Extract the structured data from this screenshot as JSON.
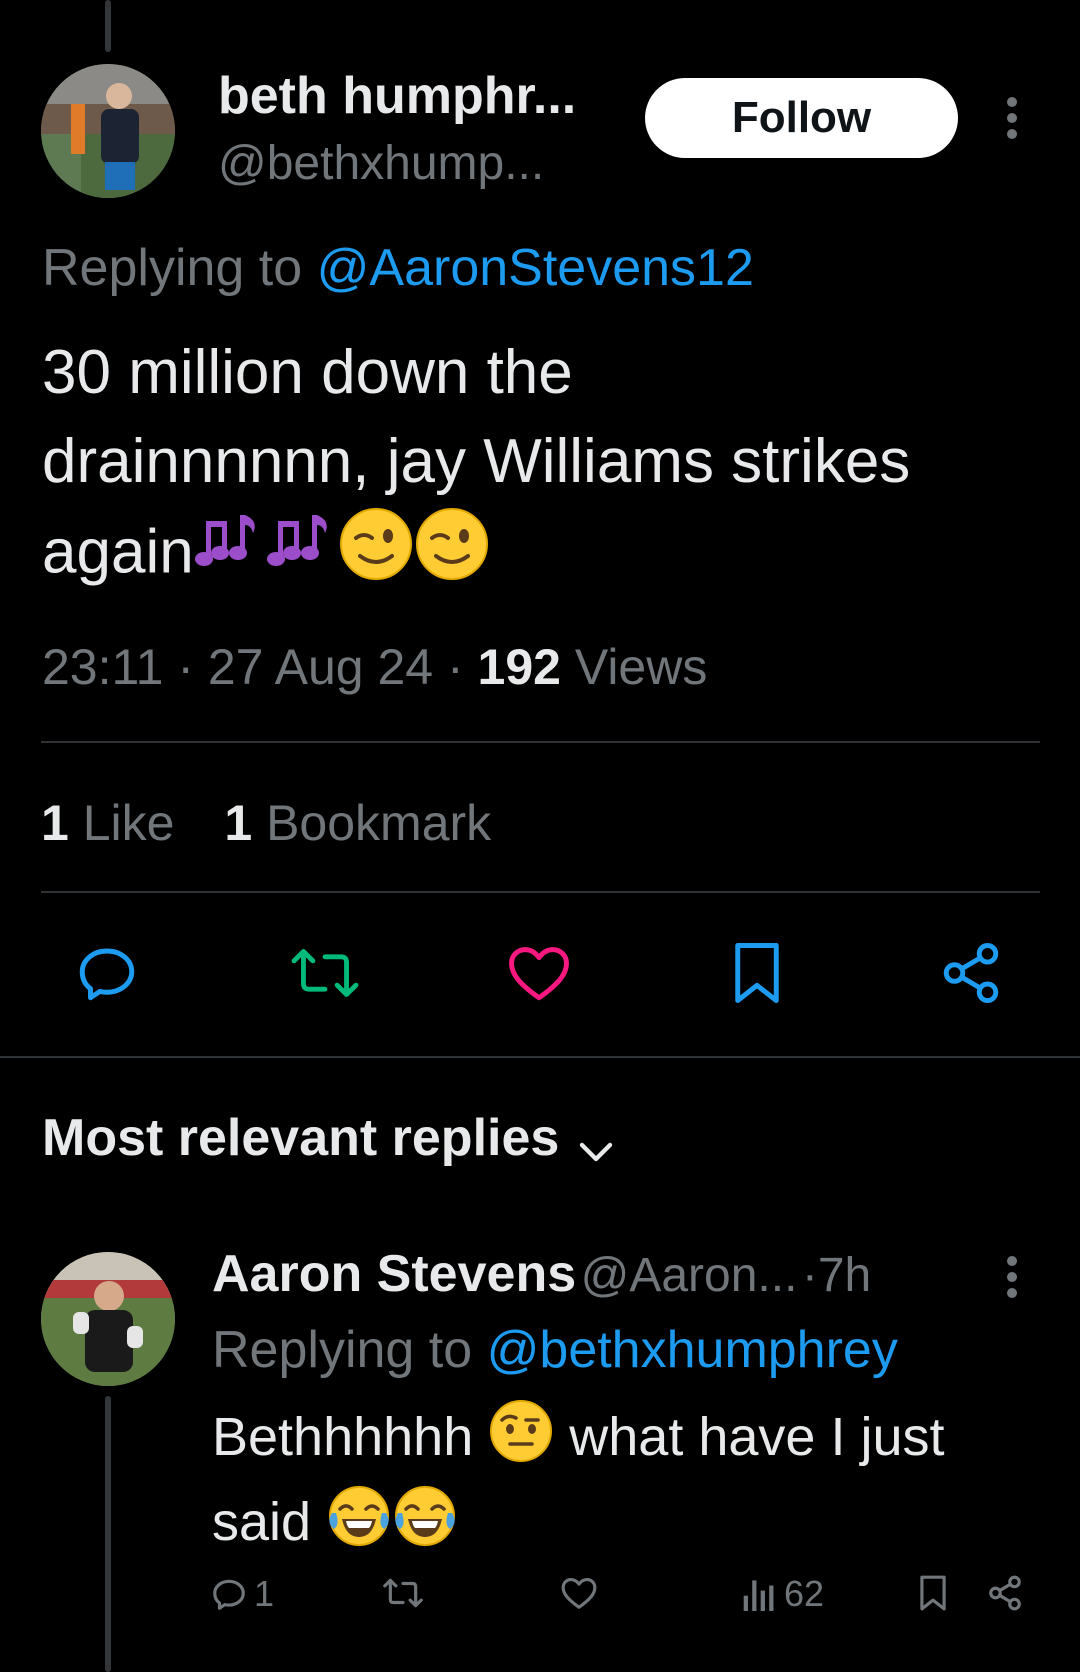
{
  "tweet": {
    "author_name": "beth humphr...",
    "author_handle": "@bethxhump...",
    "follow_label": "Follow",
    "replying_prefix": "Replying to",
    "replying_to": "@AaronStevens12",
    "text_line1": "30 million down the",
    "text_line2": "drainnnnnn, jay Williams strikes",
    "text_line3": "again",
    "time": "23:11",
    "date": "27 Aug 24",
    "views_count": "192",
    "views_label": "Views",
    "likes_count": "1",
    "likes_label": "Like",
    "bookmarks_count": "1",
    "bookmarks_label": "Bookmark",
    "trailing_emoji": [
      "musical-notes",
      "musical-notes",
      "winking-face",
      "winking-face"
    ]
  },
  "actions": {
    "icons": [
      "reply-icon",
      "retweet-icon",
      "like-icon",
      "bookmark-icon",
      "share-icon"
    ]
  },
  "replies_sort": {
    "label": "Most relevant replies"
  },
  "reply": {
    "author_name": "Aaron Stevens",
    "author_handle": "@Aaron...",
    "separator": "·",
    "age": "7h",
    "replying_prefix": "Replying to",
    "replying_to": "@bethxhumphrey",
    "text_part1": "Bethhhhhh",
    "text_part2": "what have I just",
    "text_part3": "said",
    "reply_count": "1",
    "views_count": "62",
    "emoji": [
      "face-with-raised-eyebrow",
      "tears-of-joy",
      "tears-of-joy"
    ]
  },
  "colors": {
    "background": "#000000",
    "text": "#e7e9ea",
    "secondary": "#71767b",
    "link": "#1d9bf0",
    "divider": "#2f3336"
  }
}
